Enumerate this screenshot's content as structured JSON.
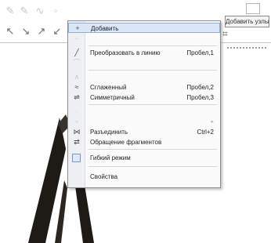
{
  "toolbar": {
    "top_right_button": "Добавить узлы"
  },
  "context_menu": {
    "items": [
      {
        "label": "Добавить",
        "shortcut": "",
        "icon": "add-node-icon",
        "enabled": true,
        "highlighted": true
      },
      {
        "label": "",
        "shortcut": "",
        "icon": "delete-node-icon",
        "enabled": false
      },
      {
        "label": "Преобразовать в линию",
        "shortcut": "Пробел,1",
        "icon": "to-line-icon",
        "enabled": true
      },
      {
        "label": "",
        "shortcut": "",
        "icon": "to-curve-icon",
        "enabled": false
      },
      {
        "label": "",
        "shortcut": "",
        "icon": "cusp-icon",
        "enabled": false
      },
      {
        "label": "Сглаженный",
        "shortcut": "Пробел,2",
        "icon": "smooth-icon",
        "enabled": true
      },
      {
        "label": "Симметричный",
        "shortcut": "Пробел,3",
        "icon": "symmetric-icon",
        "enabled": true
      },
      {
        "label": "",
        "shortcut": "",
        "icon": "auto-close-icon",
        "enabled": false
      },
      {
        "label": "",
        "shortcut": "",
        "icon": "submenu-icon",
        "enabled": false
      },
      {
        "label": "Разъединить",
        "shortcut": "Ctrl+2",
        "icon": "break-apart-icon",
        "enabled": true
      },
      {
        "label": "Обращение фрагментов",
        "shortcut": "",
        "icon": "reverse-direction-icon",
        "enabled": true
      },
      {
        "label": "Гибкий режим",
        "shortcut": "",
        "icon": "elastic-mode-icon",
        "enabled": true,
        "checked": true
      },
      {
        "label": "Свойства",
        "shortcut": "",
        "icon": "properties-icon",
        "enabled": true
      }
    ]
  }
}
